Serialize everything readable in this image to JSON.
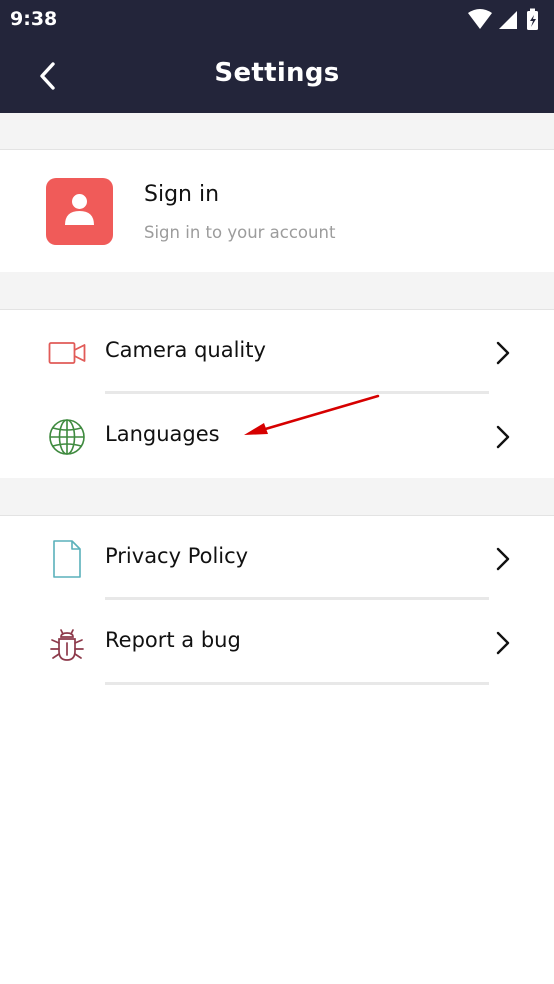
{
  "status_bar": {
    "time": "9:38",
    "icons": [
      "wifi-icon",
      "signal-icon",
      "battery-icon"
    ]
  },
  "app_bar": {
    "title": "Settings",
    "back_icon": "back-arrow-icon",
    "background": "#23253a"
  },
  "account": {
    "title": "Sign in",
    "subtitle": "Sign in to your account",
    "avatar_icon": "person-icon",
    "avatar_color": "#f05b59"
  },
  "sections": [
    {
      "items": [
        {
          "label": "Camera quality",
          "icon": "video-camera-icon",
          "color": "#e15b58"
        },
        {
          "label": "Languages",
          "icon": "globe-icon",
          "color": "#3f8a3f"
        }
      ]
    },
    {
      "items": [
        {
          "label": "Privacy Policy",
          "icon": "document-icon",
          "color": "#5ab1bb"
        },
        {
          "label": "Report a bug",
          "icon": "bug-icon",
          "color": "#8d3a4b"
        }
      ]
    }
  ],
  "annotation": {
    "type": "red-arrow",
    "target": "Languages",
    "color": "#d60000"
  },
  "colors": {
    "section_gap": "#f4f4f4",
    "divider": "#e8e8e8",
    "subtitle": "#9c9c9c"
  }
}
